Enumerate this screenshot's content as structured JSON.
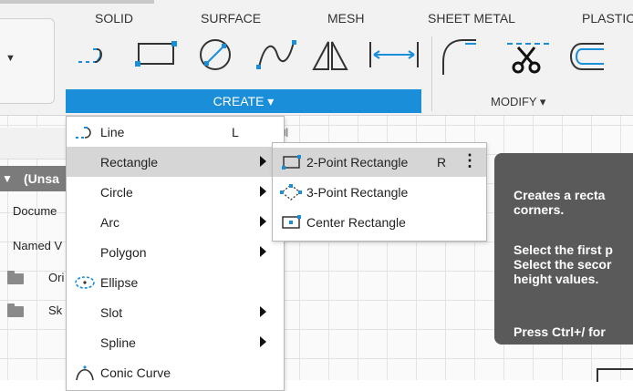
{
  "toolbar": {
    "tabs": [
      "SOLID",
      "SURFACE",
      "MESH",
      "SHEET METAL",
      "PLASTIC"
    ],
    "create_label": "CREATE ▾",
    "modify_label": "MODIFY ▾",
    "create_icons": [
      "line-tool-icon",
      "rectangle-tool-icon",
      "circle-tool-icon",
      "spline-tool-icon",
      "mirror-tool-icon",
      "dimension-tool-icon"
    ],
    "modify_icons": [
      "fillet-icon",
      "trim-scissors-icon",
      "offset-icon"
    ],
    "accent_color": "#1a8ed8"
  },
  "browser": {
    "root_label": "(Unsa",
    "items": [
      "Docume",
      "Named V",
      "Ori",
      "Sk"
    ]
  },
  "create_menu": {
    "items": [
      {
        "label": "Line",
        "shortcut": "L",
        "submenu": false,
        "icon": "line-icon"
      },
      {
        "label": "Rectangle",
        "shortcut": "",
        "submenu": true,
        "highlighted": true,
        "icon": ""
      },
      {
        "label": "Circle",
        "shortcut": "",
        "submenu": true,
        "icon": ""
      },
      {
        "label": "Arc",
        "shortcut": "",
        "submenu": true,
        "icon": ""
      },
      {
        "label": "Polygon",
        "shortcut": "",
        "submenu": true,
        "icon": ""
      },
      {
        "label": "Ellipse",
        "shortcut": "",
        "submenu": false,
        "icon": "ellipse-icon"
      },
      {
        "label": "Slot",
        "shortcut": "",
        "submenu": true,
        "icon": ""
      },
      {
        "label": "Spline",
        "shortcut": "",
        "submenu": true,
        "icon": ""
      },
      {
        "label": "Conic Curve",
        "shortcut": "",
        "submenu": false,
        "icon": "conic-curve-icon"
      }
    ]
  },
  "rectangle_submenu": {
    "items": [
      {
        "label": "2-Point Rectangle",
        "shortcut": "R",
        "icon": "two-point-rectangle-icon",
        "highlighted": true
      },
      {
        "label": "3-Point Rectangle",
        "shortcut": "",
        "icon": "three-point-rectangle-icon"
      },
      {
        "label": "Center Rectangle",
        "shortcut": "",
        "icon": "center-rectangle-icon"
      }
    ],
    "more_label": "⋮"
  },
  "tooltip": {
    "paragraphs": [
      "Creates a recta\ncorners.",
      "Select the first p\nSelect the secor\nheight values.",
      "Press Ctrl+/ for"
    ]
  }
}
